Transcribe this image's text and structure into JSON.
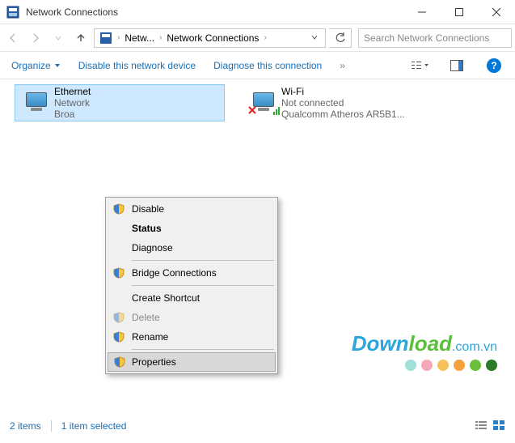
{
  "title": "Network Connections",
  "breadcrumb": {
    "seg1": "Netw...",
    "seg2": "Network Connections"
  },
  "search": {
    "placeholder": "Search Network Connections"
  },
  "toolbar": {
    "organize": "Organize",
    "disable": "Disable this network device",
    "diagnose": "Diagnose this connection",
    "more": "»"
  },
  "adapters": {
    "ethernet": {
      "name": "Ethernet",
      "line1": "Network",
      "line2": "Broa"
    },
    "wifi": {
      "name": "Wi-Fi",
      "line1": "Not connected",
      "line2": "Qualcomm Atheros AR5B1..."
    }
  },
  "ctx": {
    "disable": "Disable",
    "status": "Status",
    "diagnose": "Diagnose",
    "bridge": "Bridge Connections",
    "shortcut": "Create Shortcut",
    "delete": "Delete",
    "rename": "Rename",
    "properties": "Properties"
  },
  "status": {
    "items": "2 items",
    "selected": "1 item selected"
  },
  "watermark": {
    "text1": "Down",
    "text2": "load",
    "domain": ".com.vn"
  },
  "dotcolors": [
    "#9fe0d8",
    "#f4a8b8",
    "#f7c159",
    "#f2a23a",
    "#6bbf3a",
    "#2a7a2a"
  ]
}
